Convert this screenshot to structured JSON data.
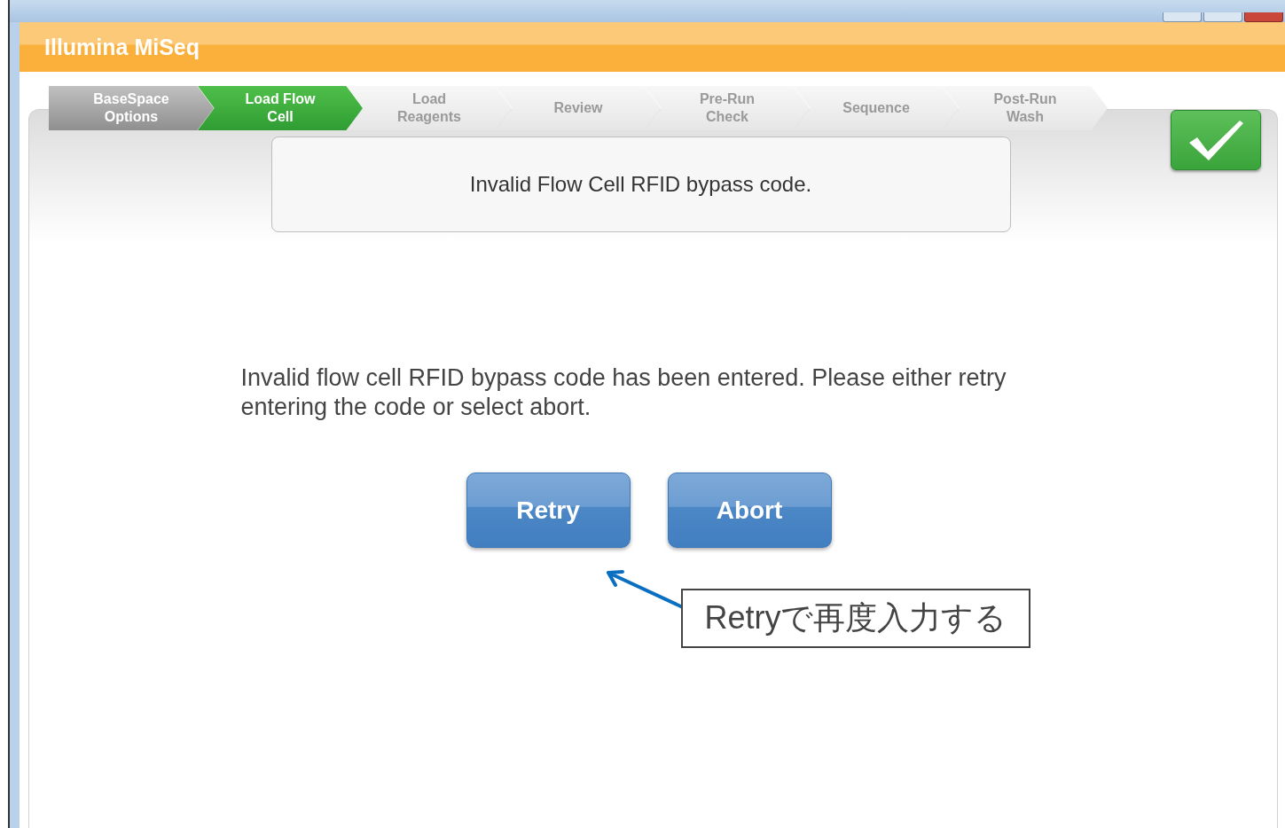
{
  "app": {
    "title": "Illumina MiSeq"
  },
  "steps": [
    {
      "label": "BaseSpace Options",
      "completed": true,
      "selected": false
    },
    {
      "label": "Load Flow Cell",
      "completed": false,
      "selected": true
    },
    {
      "label": "Load Reagents",
      "completed": false,
      "selected": false
    },
    {
      "label": "Review",
      "completed": false,
      "selected": false
    },
    {
      "label": "Pre-Run Check",
      "completed": false,
      "selected": false
    },
    {
      "label": "Sequence",
      "completed": false,
      "selected": false
    },
    {
      "label": "Post-Run Wash",
      "completed": false,
      "selected": false
    }
  ],
  "message_title": "Invalid Flow Cell RFID bypass code.",
  "message_body": "Invalid flow cell RFID bypass code has been entered.  Please either retry entering the code or select abort.",
  "buttons": [
    "Retry",
    "Abort"
  ],
  "annotation": {
    "text": "Retryで再度入力する"
  }
}
